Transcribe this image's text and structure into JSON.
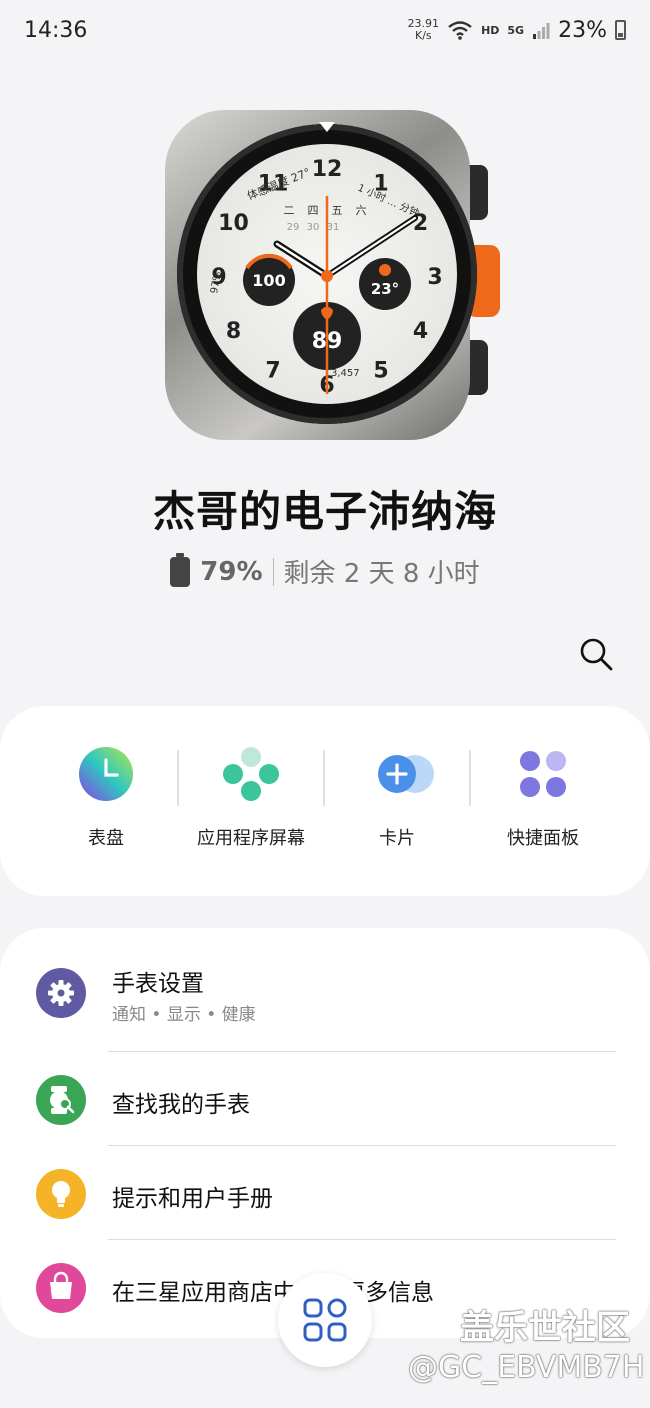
{
  "status_bar": {
    "time": "14:36",
    "net_speed_value": "23.91",
    "net_speed_unit": "K/s",
    "hd": "HD",
    "network": "5G",
    "battery": "23%"
  },
  "watch_face": {
    "numerals": [
      "12",
      "1",
      "2",
      "3",
      "4",
      "5",
      "6",
      "7",
      "8",
      "9",
      "10",
      "11"
    ],
    "weather_label": "体感温度 27°",
    "week_days": [
      "二",
      "四",
      "五",
      "六"
    ],
    "date_numbers": [
      "29",
      "30",
      "31"
    ],
    "battery_value": "100",
    "temperature": "23°",
    "heart_rate": "89",
    "steps": "3,457",
    "side_percent": "97%",
    "minutes_label": "1 小时 … 分钟"
  },
  "device": {
    "name": "杰哥的电子沛纳海",
    "battery_percent": "79%",
    "battery_remaining": "剩余 2 天 8 小时"
  },
  "quick_actions": [
    {
      "label": "表盘",
      "icon": "watch-face-icon"
    },
    {
      "label": "应用程序屏幕",
      "icon": "apps-screen-icon"
    },
    {
      "label": "卡片",
      "icon": "tiles-icon"
    },
    {
      "label": "快捷面板",
      "icon": "quick-panel-icon"
    }
  ],
  "menu": [
    {
      "title": "手表设置",
      "subtitle": "通知 • 显示 • 健康",
      "icon": "gear-icon",
      "color": "#5f5aa2"
    },
    {
      "title": "查找我的手表",
      "subtitle": "",
      "icon": "find-watch-icon",
      "color": "#3aa655"
    },
    {
      "title": "提示和用户手册",
      "subtitle": "",
      "icon": "lightbulb-icon",
      "color": "#f5b427"
    },
    {
      "title": "在三星应用商店中获取更多信息",
      "subtitle": "",
      "icon": "store-bag-icon",
      "color": "#e0499a"
    }
  ],
  "watermark": {
    "line1": "盖乐世社区",
    "line2": "@GC_EBVMB7H"
  },
  "colors": {
    "accent_orange": "#ee6a1a",
    "background": "#f4f4f6",
    "card": "#ffffff"
  }
}
